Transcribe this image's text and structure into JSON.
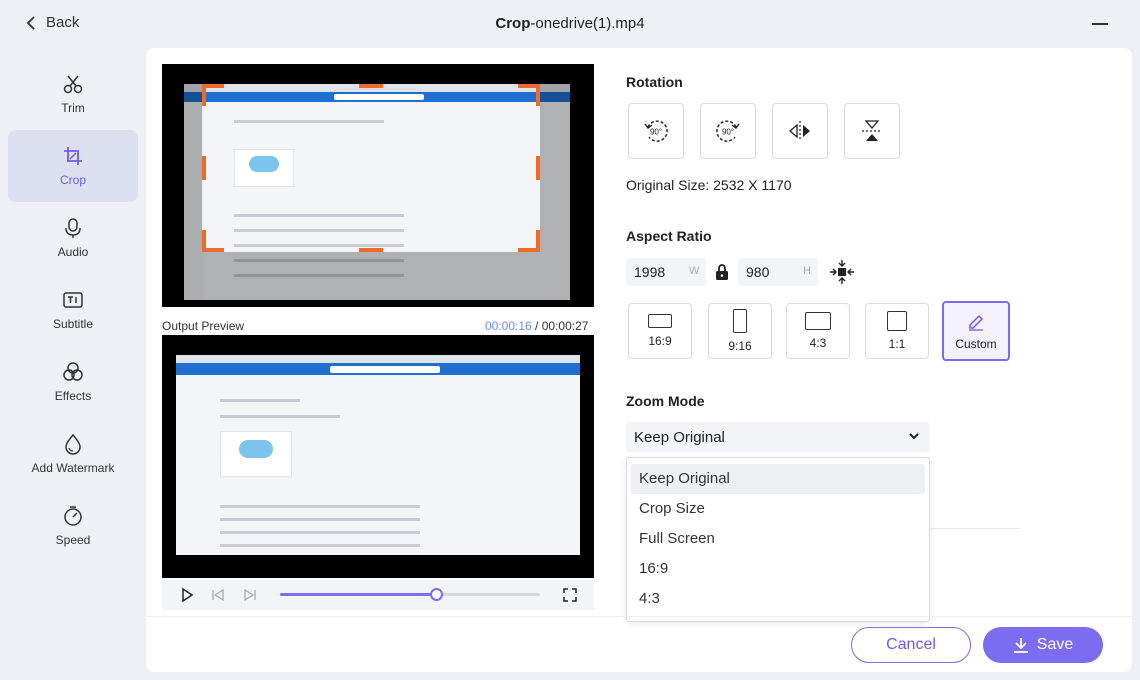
{
  "header": {
    "back_label": "Back",
    "title_prefix": "Crop",
    "title_file": "-onedrive(1).mp4"
  },
  "sidebar": {
    "items": [
      {
        "label": "Trim",
        "icon": "scissors-icon",
        "active": false
      },
      {
        "label": "Crop",
        "icon": "crop-icon",
        "active": true
      },
      {
        "label": "Audio",
        "icon": "microphone-icon",
        "active": false
      },
      {
        "label": "Subtitle",
        "icon": "subtitle-icon",
        "active": false
      },
      {
        "label": "Effects",
        "icon": "effects-icon",
        "active": false
      },
      {
        "label": "Add Watermark",
        "icon": "watermark-drop-icon",
        "active": false
      },
      {
        "label": "Speed",
        "icon": "speed-gauge-icon",
        "active": false
      }
    ]
  },
  "preview": {
    "output_label": "Output Preview",
    "time_current": "00:00:16",
    "time_separator": " / ",
    "time_total": "00:00:27",
    "progress": 0.6
  },
  "rotation": {
    "title": "Rotation",
    "buttons": [
      {
        "name": "rotate-left-90",
        "label": "90°",
        "icon": "rotate-ccw-icon"
      },
      {
        "name": "rotate-right-90",
        "label": "90°",
        "icon": "rotate-cw-icon"
      },
      {
        "name": "flip-horizontal",
        "icon": "flip-horizontal-icon"
      },
      {
        "name": "flip-vertical",
        "icon": "flip-vertical-icon"
      }
    ],
    "original_size": "Original Size: 2532 X 1170"
  },
  "aspect": {
    "title": "Aspect Ratio",
    "width_value": "1998",
    "width_unit": "W",
    "height_value": "980",
    "height_unit": "H",
    "ratios": [
      {
        "label": "16:9"
      },
      {
        "label": "9:16"
      },
      {
        "label": "4:3"
      },
      {
        "label": "1:1"
      },
      {
        "label": "Custom",
        "active": true
      }
    ]
  },
  "zoom": {
    "title": "Zoom Mode",
    "selected": "Keep Original",
    "options": [
      "Keep Original",
      "Crop Size",
      "Full Screen",
      "16:9",
      "4:3"
    ]
  },
  "footer": {
    "cancel_label": "Cancel",
    "save_label": "Save"
  },
  "colors": {
    "accent": "#7b6cf0",
    "crop_handle": "#f06a2a"
  }
}
